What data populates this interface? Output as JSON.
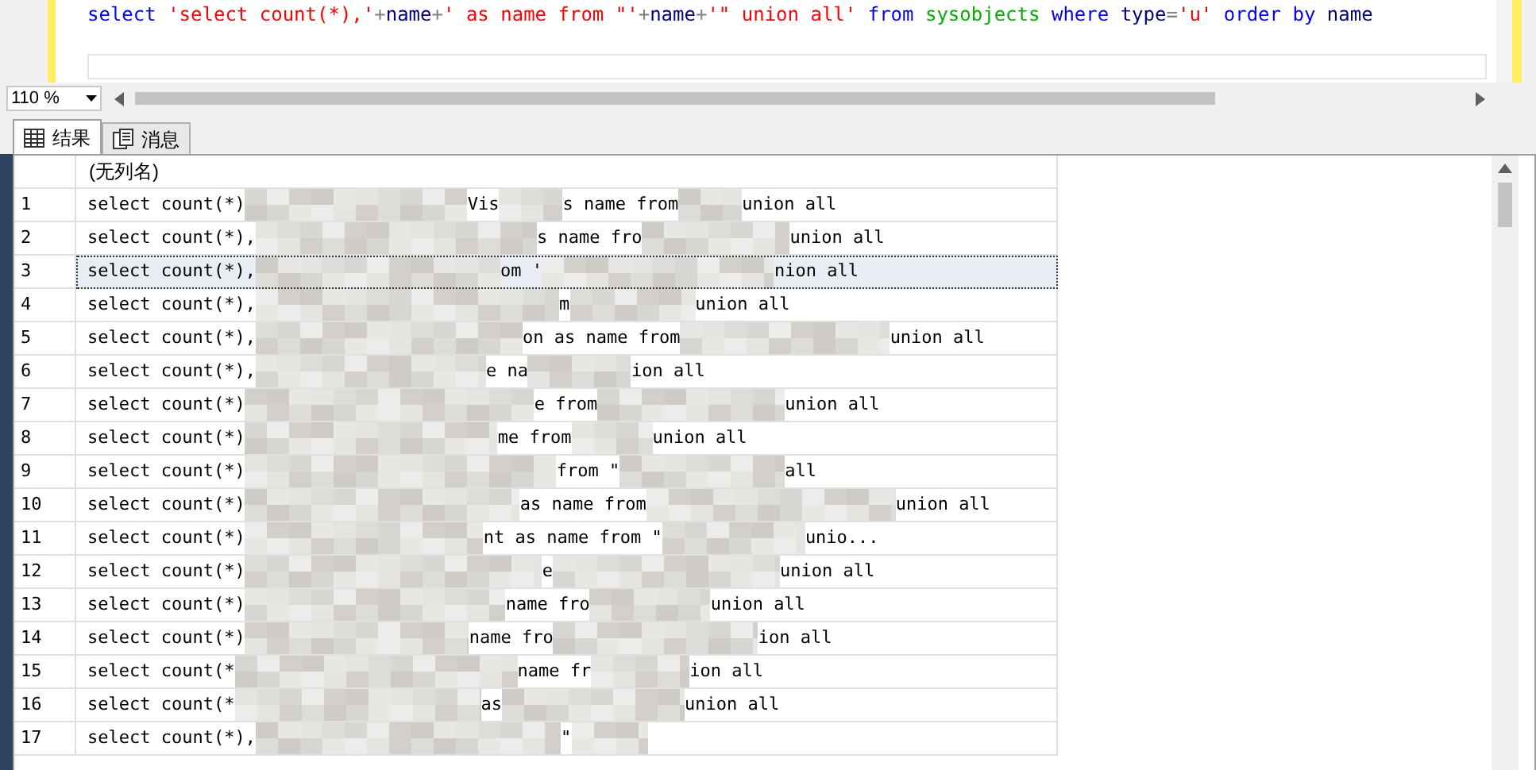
{
  "editor": {
    "tokens": [
      {
        "text": "select ",
        "kind": "keyword"
      },
      {
        "text": "'select count(*),'",
        "kind": "string"
      },
      {
        "text": "+",
        "kind": "operator"
      },
      {
        "text": "name",
        "kind": "plain"
      },
      {
        "text": "+",
        "kind": "operator"
      },
      {
        "text": "' as name from \"'",
        "kind": "string"
      },
      {
        "text": "+",
        "kind": "operator"
      },
      {
        "text": "name",
        "kind": "plain"
      },
      {
        "text": "+",
        "kind": "operator"
      },
      {
        "text": "'\" union all' ",
        "kind": "string"
      },
      {
        "text": "from ",
        "kind": "keyword"
      },
      {
        "text": "sysobjects ",
        "kind": "object"
      },
      {
        "text": "where ",
        "kind": "keyword"
      },
      {
        "text": "type",
        "kind": "plain"
      },
      {
        "text": "=",
        "kind": "operator"
      },
      {
        "text": "'u' ",
        "kind": "string"
      },
      {
        "text": "order by ",
        "kind": "keyword"
      },
      {
        "text": "name",
        "kind": "plain"
      }
    ]
  },
  "zoom": {
    "value": "110 %"
  },
  "tabs": [
    {
      "label": "结果",
      "selected": true
    },
    {
      "label": "消息",
      "selected": false
    }
  ],
  "grid": {
    "columns": [
      "(无列名)"
    ],
    "rows": [
      {
        "number": "1",
        "selected": false,
        "parts": [
          {
            "kind": "text",
            "text": "select count(*)"
          },
          {
            "kind": "redacted"
          },
          {
            "kind": "text",
            "text": "Vis"
          },
          {
            "kind": "redacted"
          },
          {
            "kind": "text",
            "text": "s name from"
          },
          {
            "kind": "redacted"
          },
          {
            "kind": "text",
            "text": "union all"
          }
        ]
      },
      {
        "number": "2",
        "selected": false,
        "parts": [
          {
            "kind": "text",
            "text": "select count(*),"
          },
          {
            "kind": "redacted"
          },
          {
            "kind": "text",
            "text": "s name fro"
          },
          {
            "kind": "redacted"
          },
          {
            "kind": "text",
            "text": "union all"
          }
        ]
      },
      {
        "number": "3",
        "selected": true,
        "parts": [
          {
            "kind": "text",
            "text": "select count(*),"
          },
          {
            "kind": "redacted"
          },
          {
            "kind": "text",
            "text": "om '"
          },
          {
            "kind": "redacted"
          },
          {
            "kind": "text",
            "text": "nion all"
          }
        ]
      },
      {
        "number": "4",
        "selected": false,
        "parts": [
          {
            "kind": "text",
            "text": "select count(*),"
          },
          {
            "kind": "redacted"
          },
          {
            "kind": "text",
            "text": "m"
          },
          {
            "kind": "redacted"
          },
          {
            "kind": "text",
            "text": "union all"
          }
        ]
      },
      {
        "number": "5",
        "selected": false,
        "parts": [
          {
            "kind": "text",
            "text": "select count(*),"
          },
          {
            "kind": "redacted"
          },
          {
            "kind": "text",
            "text": "on as name from"
          },
          {
            "kind": "redacted"
          },
          {
            "kind": "text",
            "text": "union all"
          }
        ]
      },
      {
        "number": "6",
        "selected": false,
        "parts": [
          {
            "kind": "text",
            "text": "select count(*),"
          },
          {
            "kind": "redacted"
          },
          {
            "kind": "text",
            "text": "e na"
          },
          {
            "kind": "redacted"
          },
          {
            "kind": "text",
            "text": "ion all"
          }
        ]
      },
      {
        "number": "7",
        "selected": false,
        "parts": [
          {
            "kind": "text",
            "text": "select count(*)"
          },
          {
            "kind": "redacted"
          },
          {
            "kind": "text",
            "text": "e from"
          },
          {
            "kind": "redacted"
          },
          {
            "kind": "text",
            "text": "union all"
          }
        ]
      },
      {
        "number": "8",
        "selected": false,
        "parts": [
          {
            "kind": "text",
            "text": "select count(*)"
          },
          {
            "kind": "redacted"
          },
          {
            "kind": "text",
            "text": "me from"
          },
          {
            "kind": "redacted"
          },
          {
            "kind": "text",
            "text": "union all"
          }
        ]
      },
      {
        "number": "9",
        "selected": false,
        "parts": [
          {
            "kind": "text",
            "text": "select count(*)"
          },
          {
            "kind": "redacted"
          },
          {
            "kind": "text",
            "text": "from \""
          },
          {
            "kind": "redacted"
          },
          {
            "kind": "text",
            "text": "all"
          }
        ]
      },
      {
        "number": "10",
        "selected": false,
        "parts": [
          {
            "kind": "text",
            "text": "select count(*)"
          },
          {
            "kind": "redacted"
          },
          {
            "kind": "text",
            "text": "as name from"
          },
          {
            "kind": "redacted"
          },
          {
            "kind": "text",
            "text": "union all"
          }
        ]
      },
      {
        "number": "11",
        "selected": false,
        "parts": [
          {
            "kind": "text",
            "text": "select count(*)"
          },
          {
            "kind": "redacted"
          },
          {
            "kind": "text",
            "text": "nt as name from \""
          },
          {
            "kind": "redacted"
          },
          {
            "kind": "text",
            "text": "unio..."
          }
        ]
      },
      {
        "number": "12",
        "selected": false,
        "parts": [
          {
            "kind": "text",
            "text": "select count(*)"
          },
          {
            "kind": "redacted"
          },
          {
            "kind": "text",
            "text": "e"
          },
          {
            "kind": "redacted"
          },
          {
            "kind": "text",
            "text": "union all"
          }
        ]
      },
      {
        "number": "13",
        "selected": false,
        "parts": [
          {
            "kind": "text",
            "text": "select count(*)"
          },
          {
            "kind": "redacted"
          },
          {
            "kind": "text",
            "text": "name fro"
          },
          {
            "kind": "redacted"
          },
          {
            "kind": "text",
            "text": "union all"
          }
        ]
      },
      {
        "number": "14",
        "selected": false,
        "parts": [
          {
            "kind": "text",
            "text": "select count(*)"
          },
          {
            "kind": "redacted"
          },
          {
            "kind": "text",
            "text": "name fro"
          },
          {
            "kind": "redacted"
          },
          {
            "kind": "text",
            "text": "ion all"
          }
        ]
      },
      {
        "number": "15",
        "selected": false,
        "parts": [
          {
            "kind": "text",
            "text": "select count(*"
          },
          {
            "kind": "redacted"
          },
          {
            "kind": "text",
            "text": "name fr"
          },
          {
            "kind": "redacted"
          },
          {
            "kind": "text",
            "text": "ion all"
          }
        ]
      },
      {
        "number": "16",
        "selected": false,
        "parts": [
          {
            "kind": "text",
            "text": "select count(*"
          },
          {
            "kind": "redacted"
          },
          {
            "kind": "text",
            "text": "as"
          },
          {
            "kind": "redacted"
          },
          {
            "kind": "text",
            "text": "union all"
          }
        ]
      },
      {
        "number": "17",
        "selected": false,
        "parts": [
          {
            "kind": "text",
            "text": "select count(*),"
          },
          {
            "kind": "redacted"
          },
          {
            "kind": "text",
            "text": "\""
          },
          {
            "kind": "redacted"
          }
        ]
      }
    ]
  }
}
